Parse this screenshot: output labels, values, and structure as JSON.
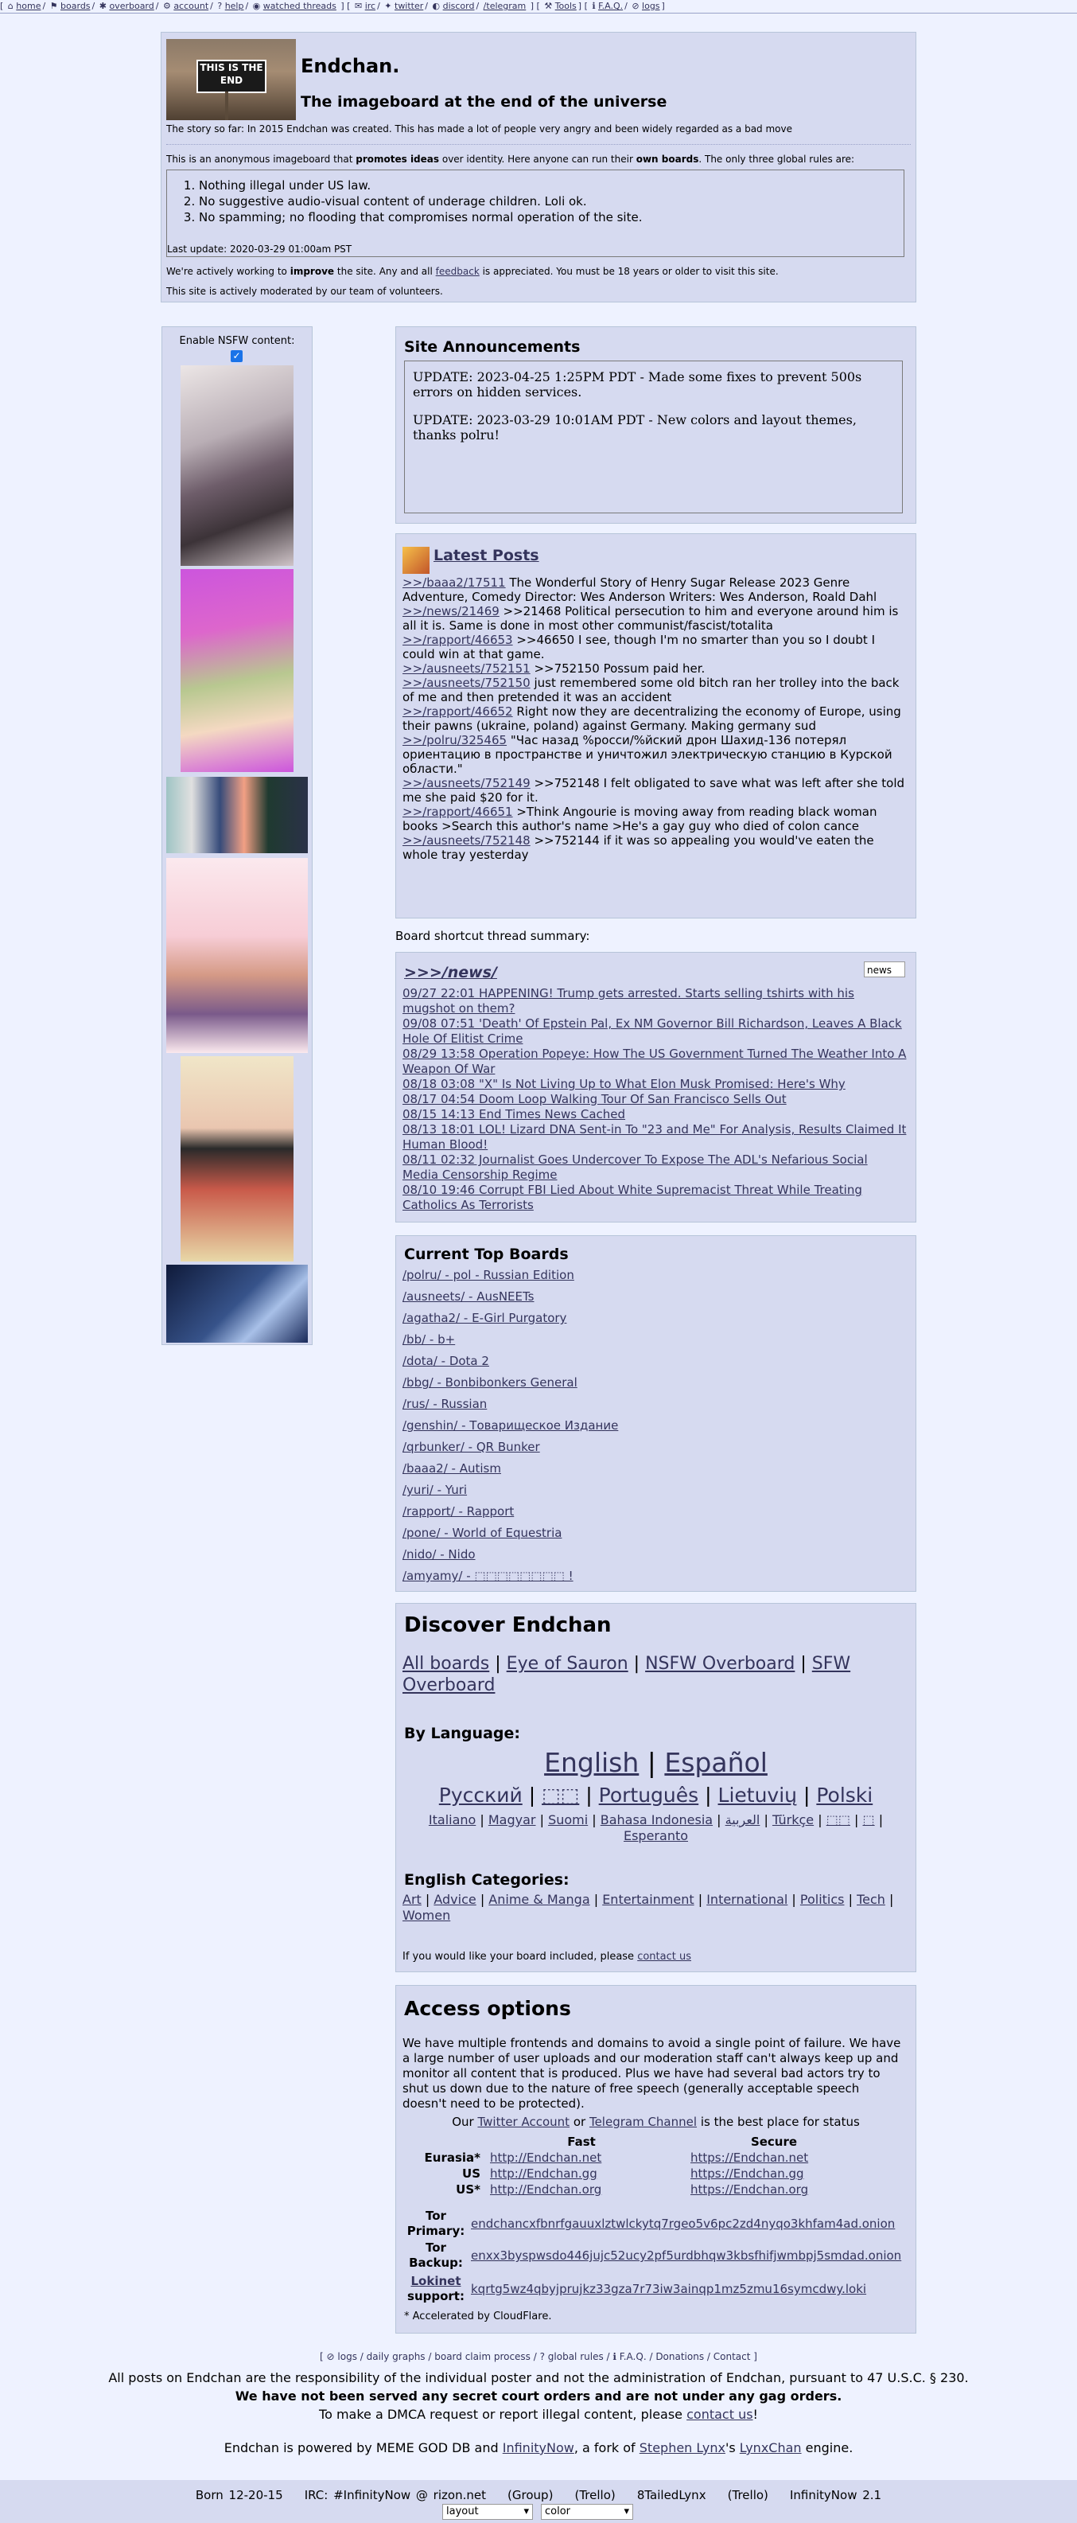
{
  "topnav": {
    "items": [
      "home",
      "boards",
      "overboard",
      "account",
      "help",
      "watched threads"
    ],
    "external": [
      "irc",
      "twitter",
      "discord",
      "/telegram"
    ],
    "tools": "Tools",
    "faq": "F.A.Q.",
    "logs": "logs"
  },
  "header": {
    "logo_text": "THIS IS THE END",
    "title": "Endchan.",
    "subtitle": "The imageboard at the end of the universe",
    "story": "The story so far: In 2015 Endchan was created. This has made a lot of people very angry and been widely regarded as a bad move",
    "intro_a": "This is an anonymous imageboard that ",
    "intro_b": "promotes ideas",
    "intro_c": " over identity. Here anyone can run their ",
    "intro_d": "own boards",
    "intro_e": ". The only three global rules are:",
    "rules": [
      "Nothing illegal under US law.",
      "No suggestive audio-visual content of underage children. Loli ok.",
      "No spamming; no flooding that compromises normal operation of the site."
    ],
    "last_update": "Last update: 2020-03-29 01:00am PST",
    "improve_a": "We're actively working to ",
    "improve_b": "improve",
    "improve_c": " the site. Any and all ",
    "improve_link": "feedback",
    "improve_d": " is appreciated. You must be 18 years or older to visit this site.",
    "moderated": "This site is actively moderated by our team of volunteers."
  },
  "nsfw": {
    "label": "Enable NSFW content:",
    "checked": true
  },
  "announcements": {
    "title": "Site Announcements",
    "items": [
      "UPDATE: 2023-04-25 1:25PM PDT - Made some fixes to prevent 500s errors on hidden services.",
      "UPDATE: 2023-03-29 10:01AM PDT - New colors and layout themes, thanks polru!"
    ]
  },
  "latest": {
    "title": "Latest Posts",
    "posts": [
      {
        "link": ">>/baaa2/17511",
        "text": " The Wonderful Story of Henry Sugar Release 2023 Genre Adventure, Comedy Director: Wes Anderson Writers: Wes Anderson, Roald Dahl"
      },
      {
        "link": ">>/news/21469",
        "text": " >>21468 Political persecution to him and everyone around him is all it is. Same is done in most other communist/fascist/totalita"
      },
      {
        "link": ">>/rapport/46653",
        "text": " >>46650 I see, though I'm no smarter than you so I doubt I could win at that game."
      },
      {
        "link": ">>/ausneets/752151",
        "text": " >>752150 Possum paid her."
      },
      {
        "link": ">>/ausneets/752150",
        "text": " just remembered some old bitch ran her trolley into the back of me and then pretended it was an accident"
      },
      {
        "link": ">>/rapport/46652",
        "text": " Right now they are decentralizing the economy of Europe, using their pawns (ukraine, poland) against Germany. Making germany sud"
      },
      {
        "link": ">>/polru/325465",
        "text": " \"Час назад %росси/%йский дрон Шахид-136 потерял ориентацию в пространстве и уничтожил электрическую станцию в Курской области.\""
      },
      {
        "link": ">>/ausneets/752149",
        "text": " >>752148 I felt obligated to save what was left after she told me she paid $20 for it."
      },
      {
        "link": ">>/rapport/46651",
        "text": " >Think Angourie is moving away from reading black woman books >Search this author's name >He's a gay guy who died of colon cance"
      },
      {
        "link": ">>/ausneets/752148",
        "text": " >>752144 if it was so appealing you would've eaten the whole tray yesterday"
      }
    ]
  },
  "shortcut": {
    "label": "Board shortcut thread summary:",
    "board": ">>>/news/",
    "select_value": "news",
    "threads": [
      "09/27 22:01 HAPPENING! Trump gets arrested. Starts selling tshirts with his mugshot on them?",
      "09/08 07:51 'Death' Of Epstein Pal, Ex NM Governor Bill Richardson, Leaves A Black Hole Of Elitist Crime",
      "08/29 13:58 Operation Popeye: How The US Government Turned The Weather Into A Weapon Of War",
      "08/18 03:08 \"X\" Is Not Living Up to What Elon Musk Promised: Here's Why",
      "08/17 04:54 Doom Loop Walking Tour Of San Francisco Sells Out",
      "08/15 14:13 End Times News Cached",
      "08/13 18:01 LOL! Lizard DNA Sent-in To \"23 and Me\" For Analysis, Results Claimed It Human Blood!",
      "08/11 02:32 Journalist Goes Undercover To Expose The ADL's Nefarious Social Media Censorship Regime",
      "08/10 19:46 Corrupt FBI Lied About White Supremacist Threat While Treating Catholics As Terrorists"
    ]
  },
  "top_boards": {
    "title": "Current Top Boards",
    "items": [
      "/polru/ - pol - Russian Edition",
      "/ausneets/ - AusNEETs",
      "/agatha2/ - E-Girl Purgatory",
      "/bb/ - b+",
      "/dota/ - Dota 2",
      "/bbg/ - Bonbibonkers General",
      "/rus/ - Russian",
      "/genshin/ - Товарищеское Издание",
      "/qrbunker/ - QR Bunker",
      "/baaa2/ - Autism",
      "/yuri/ - Yuri",
      "/rapport/ - Rapport",
      "/pone/ - World of Equestria",
      "/nido/ - Nido",
      "/amyamy/ - ⬚⬚⬚⬚⬚⬚⬚⬚ !"
    ]
  },
  "discover": {
    "title": "Discover Endchan",
    "links": [
      "All boards",
      "Eye of Sauron",
      "NSFW Overboard",
      "SFW Overboard"
    ],
    "by_language": "By Language:",
    "lang_big": [
      "English",
      "Español"
    ],
    "lang_mid": [
      "Русский",
      "⬚⬚",
      "Português",
      "Lietuvių",
      "Polski"
    ],
    "lang_small": [
      "Italiano",
      "Magyar",
      "Suomi",
      "Bahasa Indonesia",
      "العربية",
      "Türkçe",
      "⬚⬚",
      "⬚",
      "Esperanto"
    ],
    "en_categories": "English Categories:",
    "categories": [
      "Art",
      "Advice",
      "Anime & Manga",
      "Entertainment",
      "International",
      "Politics",
      "Tech",
      "Women"
    ],
    "include_a": "If you would like your board included, please ",
    "include_link": "contact us"
  },
  "access": {
    "title": "Access options",
    "text": "We have multiple frontends and domains to avoid a single point of failure. We have a large number of user uploads and our moderation staff can't always keep up and monitor all content that is produced. Plus we have had several bad actors try to shut us down due to the nature of free speech (generally acceptable speech doesn't need to be protected).",
    "status_a": "Our ",
    "status_twitter": "Twitter Account",
    "status_b": " or ",
    "status_telegram": "Telegram Channel",
    "status_c": " is the best place for status",
    "col_fast": "Fast",
    "col_secure": "Secure",
    "rows": [
      {
        "label": "Eurasia*",
        "fast": "http://Endchan.net",
        "secure": "https://Endchan.net"
      },
      {
        "label": "US",
        "fast": "http://Endchan.gg",
        "secure": "https://Endchan.gg"
      },
      {
        "label": "US*",
        "fast": "http://Endchan.org",
        "secure": "https://Endchan.org"
      }
    ],
    "tor_primary_label": "Tor Primary:",
    "tor_primary": "endchancxfbnrfgauuxlztwlckytq7rgeo5v6pc2zd4nyqo3khfam4ad.onion",
    "tor_backup_label": "Tor Backup:",
    "tor_backup": "enxx3byspwsdo446jujc52ucy2pf5urdbhqw3kbsfhifjwmbpj5smdad.onion",
    "lokinet_label": "Lokinet",
    "lokinet_support": "support:",
    "lokinet": "kqrtg5wz4qbyjprujkz33gza7r73iw3ainqp1mz5zmu16symcdwy.loki",
    "cloudflare": "* Accelerated by CloudFlare."
  },
  "footer": {
    "links": [
      "logs",
      "daily graphs",
      "board claim process",
      "global rules",
      "F.A.Q.",
      "Donations",
      "Contact"
    ],
    "line1": "All posts on Endchan are the responsibility of the individual poster and not the administration of Endchan, pursuant to 47 U.S.C. § 230.",
    "line2": "We have not been served any secret court orders and are not under any gag orders.",
    "line3_a": "To make a DMCA request or report illegal content, please ",
    "line3_link": "contact us",
    "line3_b": "!",
    "powered_a": "Endchan is powered by MEME GOD DB and ",
    "powered_link1": "InfinityNow",
    "powered_b": ", a fork of ",
    "powered_link2": "Stephen Lynx",
    "powered_c": "'s ",
    "powered_link3": "LynxChan",
    "powered_d": " engine."
  },
  "bottombar": {
    "items": [
      "Born 12-20-15",
      "IRC: #InfinityNow @ rizon.net",
      "(Group)",
      "(Trello)",
      "8TailedLynx",
      "(Trello)",
      "InfinityNow 2.1"
    ],
    "layout_select": "layout",
    "color_select": "color"
  }
}
